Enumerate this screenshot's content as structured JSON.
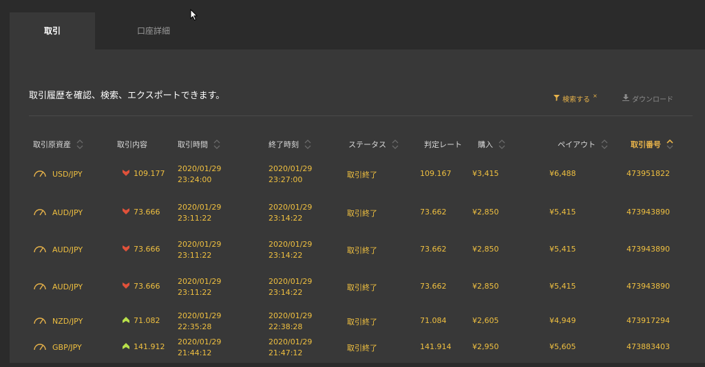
{
  "tabs": [
    {
      "label": "取引"
    },
    {
      "label": "口座詳細"
    }
  ],
  "panel": {
    "description": "取引履歴を確認、検索、エクスポートできます。",
    "filter_label": "検索する",
    "filter_clear": "×",
    "download_label": "ダウンロード"
  },
  "table": {
    "headers": [
      "取引原資産",
      "取引内容",
      "取引時間",
      "終了時刻",
      "ステータス",
      "判定レート",
      "購入",
      "ペイアウト",
      "取引番号"
    ],
    "rows": [
      {
        "asset": "USD/JPY",
        "direction": "down",
        "rate": "109.177",
        "start_date": "2020/01/29",
        "start_time": "23:24:00",
        "end_date": "2020/01/29",
        "end_time": "23:27:00",
        "status": "取引終了",
        "judge": "109.167",
        "purchase": "¥3,415",
        "payout": "¥6,488",
        "id": "473951822"
      },
      {
        "asset": "AUD/JPY",
        "direction": "down",
        "rate": "73.666",
        "start_date": "2020/01/29",
        "start_time": "23:11:22",
        "end_date": "2020/01/29",
        "end_time": "23:14:22",
        "status": "取引終了",
        "judge": "73.662",
        "purchase": "¥2,850",
        "payout": "¥5,415",
        "id": "473943890"
      },
      {
        "asset": "AUD/JPY",
        "direction": "down",
        "rate": "73.666",
        "start_date": "2020/01/29",
        "start_time": "23:11:22",
        "end_date": "2020/01/29",
        "end_time": "23:14:22",
        "status": "取引終了",
        "judge": "73.662",
        "purchase": "¥2,850",
        "payout": "¥5,415",
        "id": "473943890"
      },
      {
        "asset": "AUD/JPY",
        "direction": "down",
        "rate": "73.666",
        "start_date": "2020/01/29",
        "start_time": "23:11:22",
        "end_date": "2020/01/29",
        "end_time": "23:14:22",
        "status": "取引終了",
        "judge": "73.662",
        "purchase": "¥2,850",
        "payout": "¥5,415",
        "id": "473943890"
      },
      {
        "asset": "NZD/JPY",
        "direction": "up",
        "rate": "71.082",
        "start_date": "2020/01/29",
        "start_time": "22:35:28",
        "end_date": "2020/01/29",
        "end_time": "22:38:28",
        "status": "取引終了",
        "judge": "71.084",
        "purchase": "¥2,605",
        "payout": "¥4,949",
        "id": "473917294"
      },
      {
        "asset": "GBP/JPY",
        "direction": "up",
        "rate": "141.912",
        "start_date": "2020/01/29",
        "start_time": "21:44:12",
        "end_date": "2020/01/29",
        "end_time": "21:47:12",
        "status": "取引終了",
        "judge": "141.914",
        "purchase": "¥2,950",
        "payout": "¥5,605",
        "id": "473883403"
      }
    ]
  },
  "colors": {
    "accent": "#e8b34a",
    "down": "#e0513a",
    "up": "#b8e04a"
  },
  "icons": {
    "gauge": "gauge-icon",
    "down": "down-arrow-icon",
    "up": "up-arrow-icon",
    "filter": "filter-icon",
    "download": "download-icon",
    "sort": "sort-icon"
  }
}
